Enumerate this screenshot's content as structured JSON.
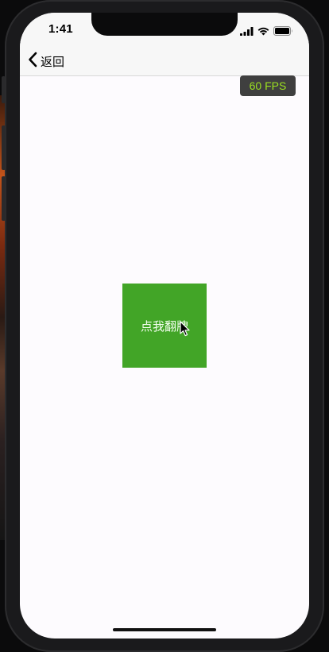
{
  "status_bar": {
    "time": "1:41",
    "icons": [
      "signal-icon",
      "wifi-icon",
      "battery-icon"
    ]
  },
  "nav_bar": {
    "back_label": "返回",
    "back_icon": "chevron-left-icon"
  },
  "fps_badge": {
    "text": "60 FPS",
    "text_color": "#9be020"
  },
  "main": {
    "flip_button_label": "点我翻牌",
    "flip_button_color": "#42a527"
  },
  "colors": {
    "screen_background": "#fdfbfe",
    "nav_background": "#f7f7f7"
  }
}
